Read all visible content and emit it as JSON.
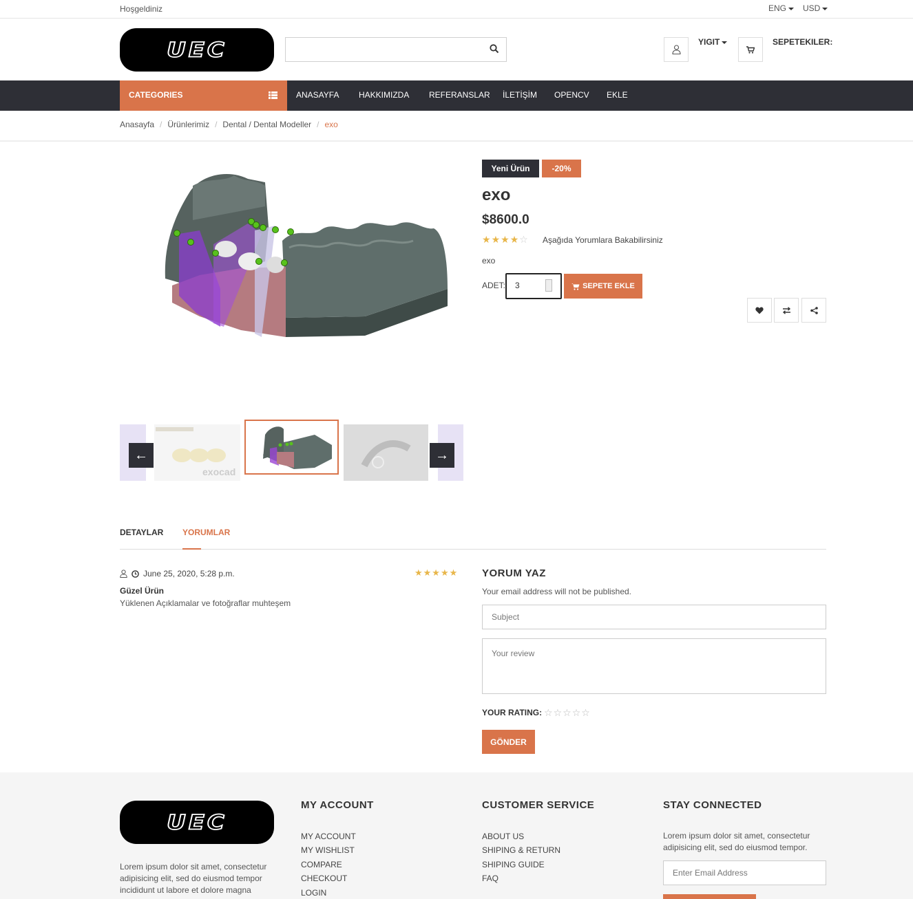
{
  "topbar": {
    "welcome": "Hoşgeldiniz",
    "language": "ENG",
    "currency": "USD"
  },
  "logo": {
    "text": "UEC"
  },
  "header": {
    "search_placeholder": "",
    "user_name": "YIGIT",
    "cart_label": "SEPETEKILER:"
  },
  "nav": {
    "categories_label": "CATEGORIES",
    "items": [
      "ANASAYFA",
      "HAKKIMIZDA",
      "REFERANSLAR",
      "İLETİŞİM",
      "OPENCV",
      "EKLE"
    ]
  },
  "breadcrumb": [
    "Anasayfa",
    "Ürünlerimiz",
    "Dental / Dental Modeller",
    "exo"
  ],
  "product": {
    "badge_new": "Yeni Ürün",
    "badge_discount": "-20%",
    "name": "exo",
    "price": "$8600.0",
    "rating": 4,
    "rating_max": 5,
    "reviews_link": "Aşağıda Yorumlara Bakabilirsiniz",
    "short_description": "exo",
    "qty_label": "ADET:",
    "qty_value": "3",
    "add_to_cart": "SEPETE EKLE",
    "thumb_text": "exocad"
  },
  "tabs": [
    "DETAYLAR",
    "YORUMLAR"
  ],
  "active_tab": "YORUMLAR",
  "review": {
    "date": "June 25, 2020, 5:28 p.m.",
    "rating": 5,
    "title": "Güzel Ürün",
    "body": "Yüklenen Açıklamalar ve fotoğraflar muhteşem"
  },
  "review_form": {
    "title": "YORUM YAZ",
    "note": "Your email address will not be published.",
    "subject_placeholder": "Subject",
    "review_placeholder": "Your review",
    "rating_label": "YOUR RATING:",
    "submit_label": "GÖNDER"
  },
  "footer": {
    "about_text": "Lorem ipsum dolor sit amet, consectetur adipisicing elit, sed do eiusmod tempor incididunt ut labore et dolore magna",
    "account": {
      "title": "MY ACCOUNT",
      "links": [
        "MY ACCOUNT",
        "MY WISHLIST",
        "COMPARE",
        "CHECKOUT",
        "LOGIN"
      ]
    },
    "service": {
      "title": "CUSTOMER SERVICE",
      "links": [
        "ABOUT US",
        "SHIPING & RETURN",
        "SHIPING GUIDE",
        "FAQ"
      ]
    },
    "connected": {
      "title": "STAY CONNECTED",
      "text": "Lorem ipsum dolor sit amet, consectetur adipisicing elit, sed do eiusmod tempor.",
      "email_placeholder": "Enter Email Address"
    }
  },
  "colors": {
    "accent": "#d9744a",
    "dark": "#2e2f36",
    "star": "#e8b64a"
  }
}
